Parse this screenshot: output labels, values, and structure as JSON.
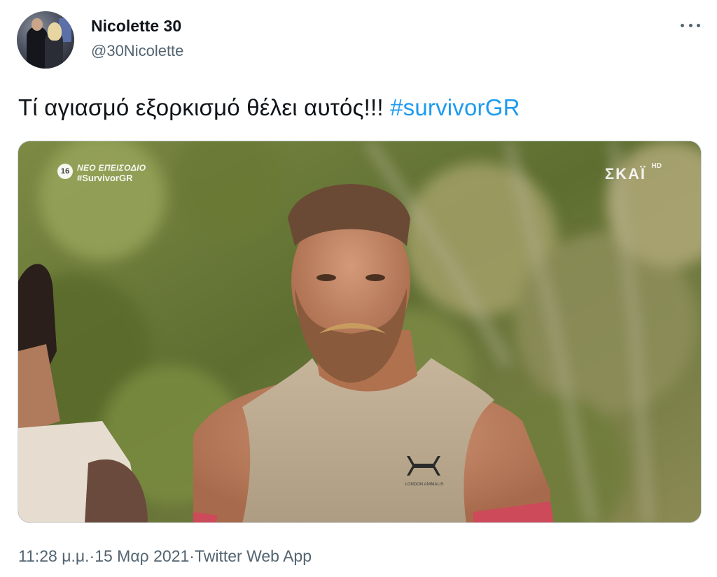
{
  "author": {
    "display_name": "Nicolette 30",
    "handle": "@30Nicolette",
    "avatar_icon": "profile-photo"
  },
  "more_icon": "ellipsis-icon",
  "tweet": {
    "text": "Τί αγιασμό εξορκισμό θέλει αυτός!!! ",
    "hashtag": "#survivorGR"
  },
  "media": {
    "overlay_badge": "16",
    "overlay_line1": "ΝΕΟ ΕΠΕΙΣΟΔΙΟ",
    "overlay_line2": "#SurvivorGR",
    "channel_logo": "ΣΚΑΪ",
    "channel_hd": "HD",
    "shirt_logo_text": "LONDON ANIMALIS"
  },
  "meta": {
    "time": "11:28 μ.μ.",
    "separator": " · ",
    "date": "15 Μαρ 2021",
    "app": "Twitter Web App"
  },
  "colors": {
    "link": "#1d9bf0",
    "secondary_text": "#536471",
    "primary_text": "#0f1419"
  }
}
